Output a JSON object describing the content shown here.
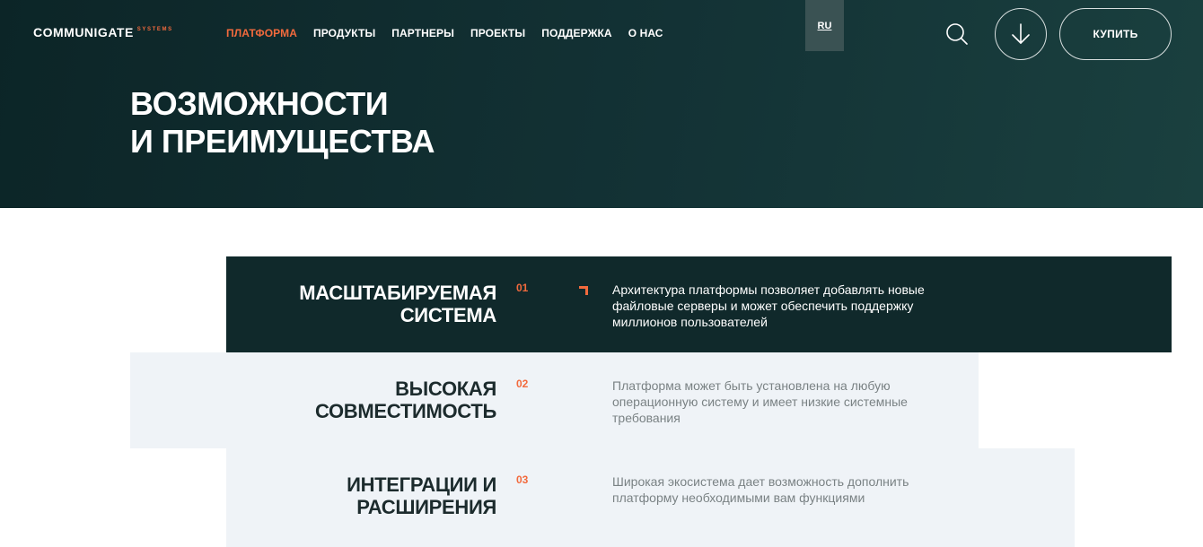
{
  "header": {
    "logo": {
      "main": "COMMUNIGATE",
      "sub": "SYSTEMS"
    },
    "nav": [
      {
        "label": "ПЛАТФОРМА",
        "active": true
      },
      {
        "label": "ПРОДУКТЫ",
        "active": false
      },
      {
        "label": "ПАРТНЕРЫ",
        "active": false
      },
      {
        "label": "ПРОЕКТЫ",
        "active": false
      },
      {
        "label": "ПОДДЕРЖКА",
        "active": false
      },
      {
        "label": "О НАС",
        "active": false
      }
    ],
    "language": "RU",
    "buy_label": "КУПИТЬ"
  },
  "hero": {
    "title_line1": "ВОЗМОЖНОСТИ",
    "title_line2": "И ПРЕИМУЩЕСТВА"
  },
  "features": [
    {
      "title_line1": "МАСШТАБИРУЕМАЯ",
      "title_line2": "СИСТЕМА",
      "number": "01",
      "description": "Архитектура платформы позволяет добавлять новые файловые серверы и может обеспечить поддержку миллионов пользователей"
    },
    {
      "title_line1": "ВЫСОКАЯ",
      "title_line2": "СОВМЕСТИМОСТЬ",
      "number": "02",
      "description": "Платформа может быть установлена на любую операционную систему и имеет низкие системные требования"
    },
    {
      "title_line1": "ИНТЕГРАЦИИ И",
      "title_line2": "РАСШИРЕНИЯ",
      "number": "03",
      "description": "Широкая экосистема дает возможность дополнить платформу необходимыми вам функциями"
    }
  ],
  "colors": {
    "accent": "#f26a3d",
    "dark": "#10292b",
    "light_panel": "#eff3f7"
  }
}
